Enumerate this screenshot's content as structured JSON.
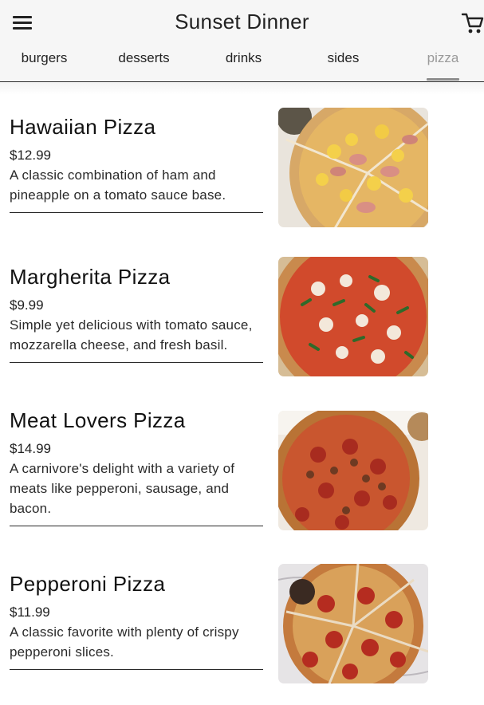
{
  "app": {
    "title": "Sunset Dinner",
    "accent": "#8d8d8d",
    "icons": {
      "menu": "menu-icon",
      "cart": "shopping-cart-icon"
    }
  },
  "tabs": [
    {
      "label": "burgers",
      "active": false
    },
    {
      "label": "desserts",
      "active": false
    },
    {
      "label": "drinks",
      "active": false
    },
    {
      "label": "sides",
      "active": false
    },
    {
      "label": "pizza",
      "active": true
    }
  ],
  "menu": {
    "items": [
      {
        "name": "Hawaiian Pizza",
        "price": "$12.99",
        "description": "A classic combination of ham and pineapple on a tomato sauce base."
      },
      {
        "name": "Margherita Pizza",
        "price": "$9.99",
        "description": "Simple yet delicious with tomato sauce, mozzarella cheese, and fresh basil."
      },
      {
        "name": "Meat Lovers Pizza",
        "price": "$14.99",
        "description": "A carnivore's delight with a variety of meats like pepperoni, sausage, and bacon."
      },
      {
        "name": "Pepperoni Pizza",
        "price": "$11.99",
        "description": "A classic favorite with plenty of crispy pepperoni slices."
      }
    ]
  }
}
